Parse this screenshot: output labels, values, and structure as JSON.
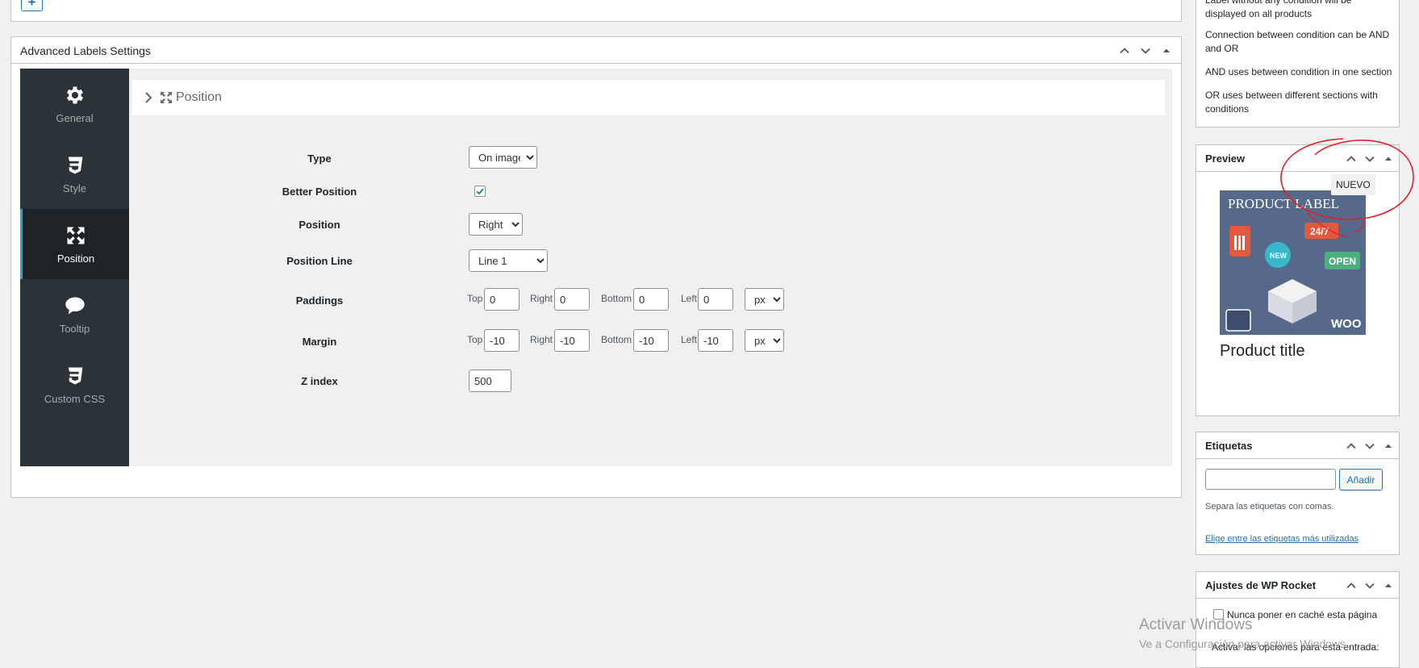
{
  "main_box": {
    "title": "Advanced Labels Settings"
  },
  "sidebar": {
    "items": [
      {
        "label": "General",
        "icon": "gear-icon"
      },
      {
        "label": "Style",
        "icon": "css3-icon"
      },
      {
        "label": "Position",
        "icon": "arrows-expand-icon",
        "active": true
      },
      {
        "label": "Tooltip",
        "icon": "speech-bubble-icon"
      },
      {
        "label": "Custom CSS",
        "icon": "css3-icon"
      }
    ]
  },
  "section": {
    "title": "Position"
  },
  "form": {
    "type": {
      "label": "Type",
      "value": "On image"
    },
    "better_position": {
      "label": "Better Position",
      "checked": true
    },
    "position": {
      "label": "Position",
      "value": "Right"
    },
    "position_line": {
      "label": "Position Line",
      "value": "Line 1"
    },
    "paddings": {
      "label": "Paddings",
      "top_label": "Top",
      "top": "0",
      "right_label": "Right",
      "right": "0",
      "bottom_label": "Bottom",
      "bottom": "0",
      "left_label": "Left",
      "left": "0",
      "unit": "px"
    },
    "margin": {
      "label": "Margin",
      "top_label": "Top",
      "top": "-10",
      "right_label": "Right",
      "right": "-10",
      "bottom_label": "Bottom",
      "bottom": "-10",
      "left_label": "Left",
      "left": "-10",
      "unit": "px"
    },
    "z_index": {
      "label": "Z index",
      "value": "500"
    }
  },
  "help_box": {
    "lines": [
      "Label without any condition will be displayed on all products",
      "Connection between condition can be AND and OR",
      "AND uses between condition in one section",
      "OR uses between different sections with conditions"
    ]
  },
  "preview_box": {
    "title": "Preview",
    "badge": "NUEVO",
    "image_text": "PRODUCT LABEL",
    "image_tags": [
      "24/7",
      "NEW",
      "OPEN",
      "WOO"
    ],
    "product_title": "Product title"
  },
  "tags_box": {
    "title": "Etiquetas",
    "add_button": "Añadir",
    "hint": "Separa las etiquetas con comas.",
    "link": "Elige entre las etiquetas más utilizadas"
  },
  "rocket_box": {
    "title": "Ajustes de WP Rocket",
    "never_cache": "Nunca poner en caché esta página",
    "activate_options": "Activar las opciones para esta entrada:"
  },
  "watermark": {
    "line1": "Activar Windows",
    "line2": "Ve a Configuración para activar Windows."
  },
  "colors": {
    "sidebar_bg": "#2c3338",
    "sidebar_active": "#1d2327",
    "accent": "#2271b1",
    "annotation": "#e0202a"
  }
}
